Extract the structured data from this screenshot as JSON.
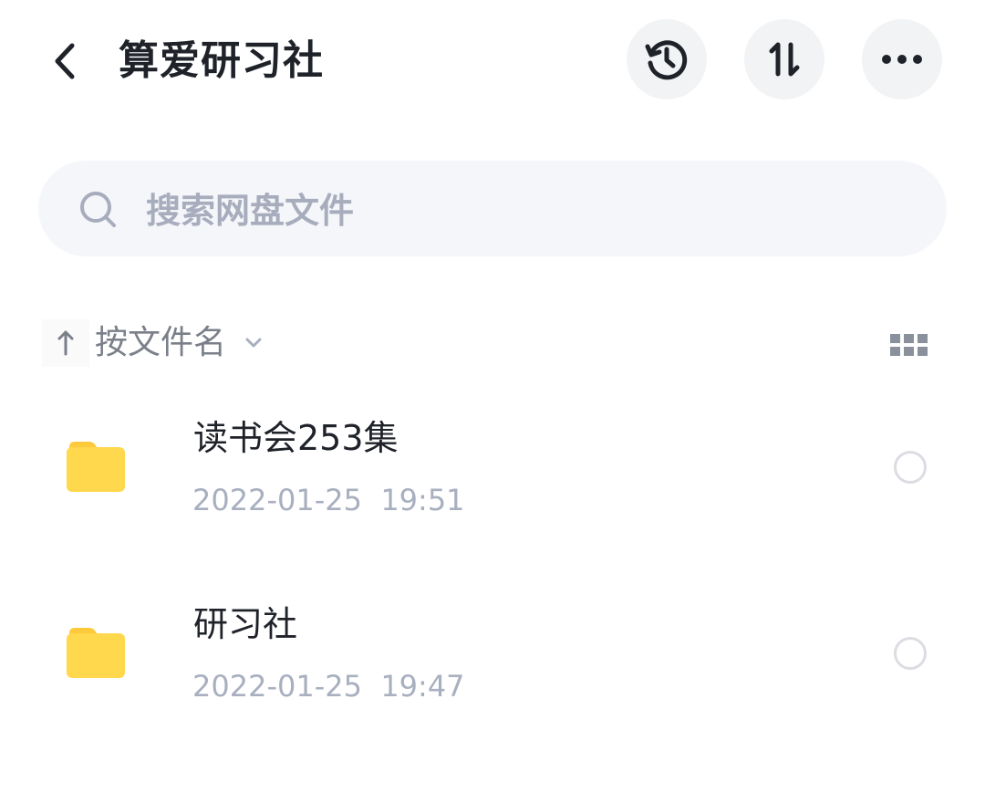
{
  "header": {
    "title": "算爱研习社"
  },
  "search": {
    "placeholder": "搜索网盘文件"
  },
  "toolbar": {
    "sort_label": "按文件名"
  },
  "files": [
    {
      "name": "读书会253集",
      "date": "2022-01-25  19:51"
    },
    {
      "name": "研习社",
      "date": "2022-01-25  19:47"
    }
  ],
  "colors": {
    "folder": "#ffd84d",
    "title_text": "#1f2329",
    "secondary_text": "#a8afbf",
    "icon_button_bg": "#f2f3f5",
    "search_bg": "#f5f6fa"
  },
  "icons": {
    "back": "chevron-left-icon",
    "history": "history-icon",
    "sort": "sort-arrows-icon",
    "more": "more-dots-icon",
    "search": "search-icon",
    "sort_direction": "arrow-up-icon",
    "sort_dropdown": "chevron-down-icon",
    "view_toggle": "grid-view-icon",
    "folder": "folder-icon"
  }
}
